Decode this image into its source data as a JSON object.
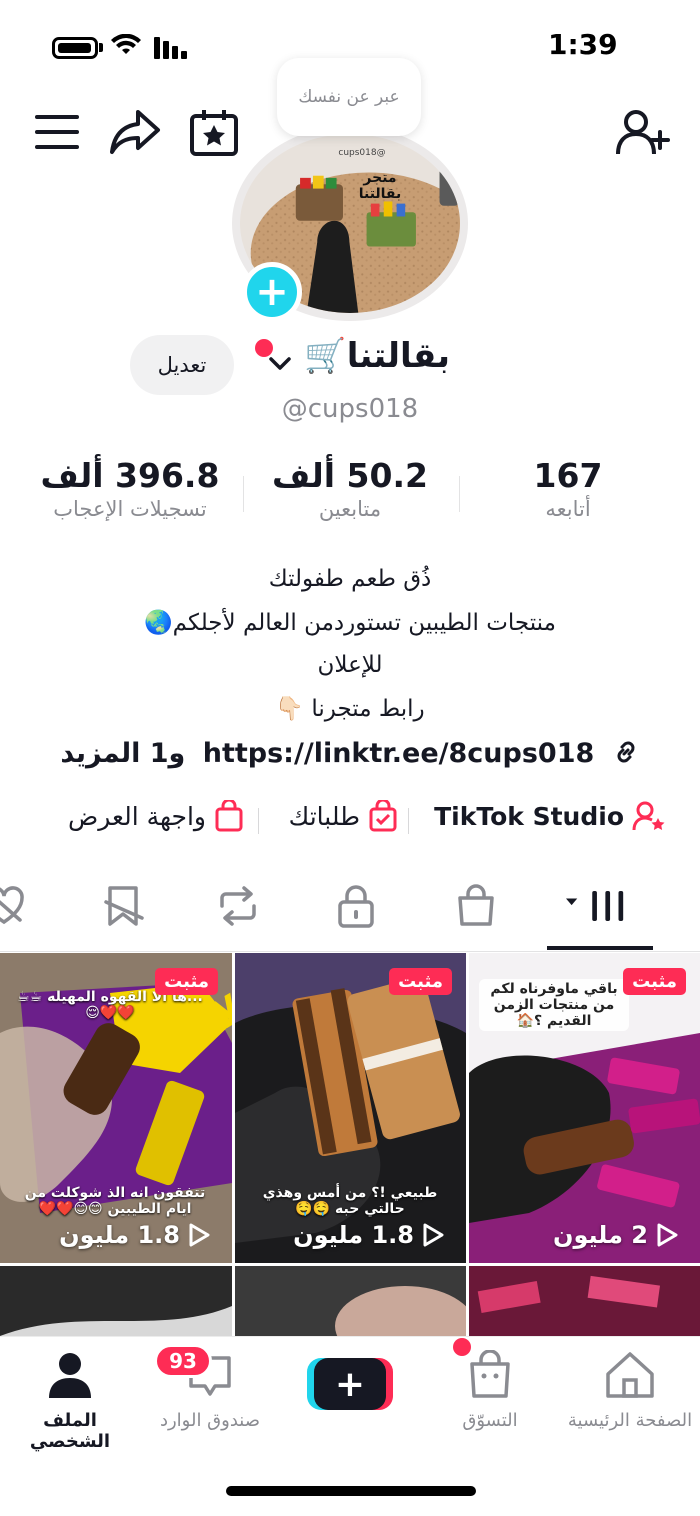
{
  "status": {
    "time": "1:39"
  },
  "profile": {
    "bubble_text": "عبر عن نفسك",
    "avatar_store_name": "متجر بقالتنا",
    "avatar_handle": "cups018@",
    "nickname": "بقالتنا🛒",
    "handle": "@cups018",
    "edit_label": "تعديل"
  },
  "stats": {
    "following": {
      "value": "167",
      "label": "أتابعه"
    },
    "followers": {
      "value": "50.2 ألف",
      "label": "متابعين"
    },
    "likes": {
      "value": "396.8 ألف",
      "label": "تسجيلات الإعجاب"
    }
  },
  "bio": {
    "line1": "ذُق طعم طفولتك",
    "line2": "منتجات الطيبين تستوردمن العالم لأجلكم🌏",
    "line3": "للإعلان",
    "line4": "رابط متجرنا 👇🏻",
    "link": "https://linktr.ee/8cups018",
    "link_more": "و1 المزيد"
  },
  "tools": {
    "studio": "TikTok Studio",
    "orders": "طلباتك",
    "showcase": "واجهة العرض"
  },
  "videos": [
    {
      "pinned": "مثبت",
      "views": "1.8 مليون",
      "text_top": "...ها ألا القهوه المهيله ☕☕❤️❤️😌",
      "text_bottom": "تتفقون انه الذ شوكلت من ايام الطيبين 😊😊❤️❤️"
    },
    {
      "pinned": "مثبت",
      "views": "1.8 مليون",
      "text_top": "",
      "text_bottom": "طبيعي !؟ من أمس وهذي حالتي حبه 🤤🤤"
    },
    {
      "pinned": "مثبت",
      "views": "2 مليون",
      "text_top": "باقي ماوفرناه لكم من منتجات الزمن القديم ؟🏠",
      "text_bottom": ""
    }
  ],
  "nav": {
    "home": "الصفحة الرئيسية",
    "shop": "التسوّق",
    "inbox": "صندوق الوارد",
    "inbox_badge": "93",
    "profile": "الملف الشخصي"
  },
  "colors": {
    "accent": "#fe2c55",
    "cyan": "#20d5ec",
    "text": "#161823",
    "muted": "#8a8b91"
  }
}
